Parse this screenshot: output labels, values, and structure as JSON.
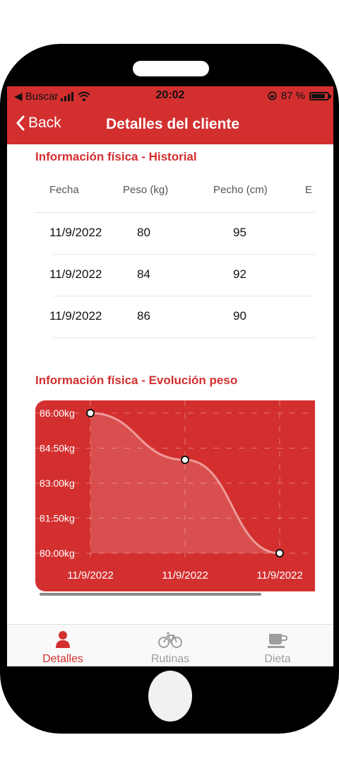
{
  "status_bar": {
    "back_app": "◀ Buscar",
    "time": "20:02",
    "battery": "87 %",
    "battery_level": 0.87
  },
  "nav": {
    "back_label": "Back",
    "title": "Detalles del cliente"
  },
  "history": {
    "title": "Información física - Historial",
    "headers": [
      "Fecha",
      "Peso (kg)",
      "Pecho (cm)",
      "E"
    ],
    "rows": [
      [
        "11/9/2022",
        "80",
        "95"
      ],
      [
        "11/9/2022",
        "84",
        "92"
      ],
      [
        "11/9/2022",
        "86",
        "90"
      ]
    ]
  },
  "evolution": {
    "title": "Información física - Evolución peso"
  },
  "chart_data": {
    "type": "line",
    "categories": [
      "11/9/2022",
      "11/9/2022",
      "11/9/2022"
    ],
    "series": [
      {
        "values": [
          86,
          84,
          80
        ]
      }
    ],
    "y_tick_labels": [
      "86.00kg",
      "84.50kg",
      "83.00kg",
      "81.50kg",
      "80.00kg"
    ],
    "ylim": [
      80,
      86
    ],
    "grid": true,
    "background_color": "#d32f2f",
    "line_color": "#ef9a9a"
  },
  "tabs": [
    {
      "label": "Detalles",
      "icon": "user-icon",
      "active": true
    },
    {
      "label": "Rutinas",
      "icon": "bicycle-icon",
      "active": false
    },
    {
      "label": "Dieta",
      "icon": "coffee-icon",
      "active": false
    }
  ],
  "colors": {
    "accent": "#d32f2f",
    "inactive_tab": "#9e9e9e"
  }
}
